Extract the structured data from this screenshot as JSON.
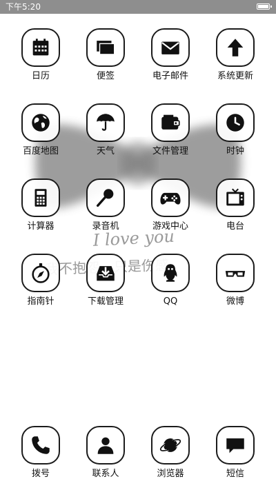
{
  "status_bar": {
    "time": "下午5:20"
  },
  "wallpaper": {
    "line1": "I love you",
    "line2": "我不抱怨，只是伤感"
  },
  "apps": [
    {
      "label": "日历",
      "icon": "calendar-icon"
    },
    {
      "label": "便签",
      "icon": "notes-icon"
    },
    {
      "label": "电子邮件",
      "icon": "mail-icon"
    },
    {
      "label": "系统更新",
      "icon": "update-arrow-icon"
    },
    {
      "label": "百度地图",
      "icon": "globe-icon"
    },
    {
      "label": "天气",
      "icon": "umbrella-icon"
    },
    {
      "label": "文件管理",
      "icon": "wallet-icon"
    },
    {
      "label": "时钟",
      "icon": "clock-icon"
    },
    {
      "label": "计算器",
      "icon": "calculator-icon"
    },
    {
      "label": "录音机",
      "icon": "microphone-icon"
    },
    {
      "label": "游戏中心",
      "icon": "gamepad-icon"
    },
    {
      "label": "电台",
      "icon": "tv-icon"
    },
    {
      "label": "指南针",
      "icon": "compass-icon"
    },
    {
      "label": "下载管理",
      "icon": "download-tray-icon"
    },
    {
      "label": "QQ",
      "icon": "qq-penguin-icon"
    },
    {
      "label": "微博",
      "icon": "3d-glasses-icon"
    }
  ],
  "dock": [
    {
      "label": "拨号",
      "icon": "phone-icon"
    },
    {
      "label": "联系人",
      "icon": "contact-person-icon"
    },
    {
      "label": "浏览器",
      "icon": "planet-icon"
    },
    {
      "label": "短信",
      "icon": "message-bubble-icon"
    }
  ]
}
